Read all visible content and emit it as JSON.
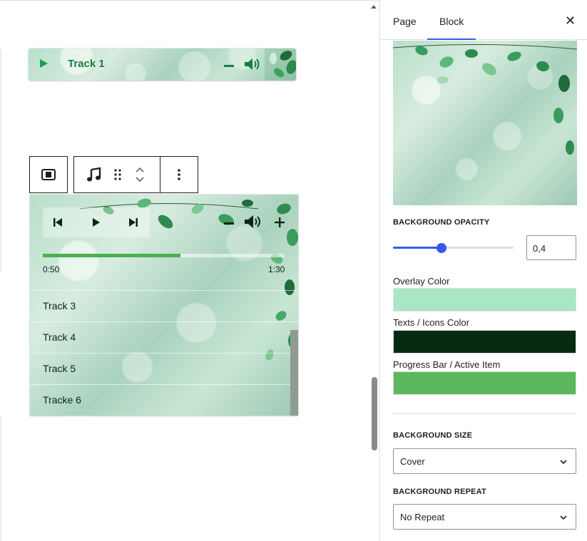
{
  "mini_player": {
    "track_title": "Track 1"
  },
  "player": {
    "progress": 0.57,
    "current_time": "0:50",
    "duration": "1:30",
    "tracks": [
      "Track 3",
      "Track 4",
      "Track 5",
      "Tracke 6"
    ]
  },
  "toolbar": {
    "icons": [
      "block-layout-icon",
      "music-note-icon",
      "drag-handle-icon",
      "move-up-icon",
      "move-down-icon",
      "more-options-icon"
    ]
  },
  "sidebar": {
    "tabs": [
      {
        "label": "Page",
        "active": false
      },
      {
        "label": "Block",
        "active": true
      }
    ],
    "close_icon": "close-icon",
    "background_opacity": {
      "label": "BACKGROUND OPACITY",
      "value": "0,4",
      "fraction": 0.4
    },
    "colors": [
      {
        "label": "Overlay Color",
        "color": "#a8e6c4"
      },
      {
        "label": "Texts / Icons Color",
        "color": "#062b10"
      },
      {
        "label": "Progress Bar / Active Item",
        "color": "#5cb85c"
      }
    ],
    "background_size": {
      "label": "BACKGROUND SIZE",
      "value": "Cover"
    },
    "background_repeat": {
      "label": "BACKGROUND REPEAT",
      "value": "No Repeat"
    }
  },
  "accent": "#3858e9"
}
